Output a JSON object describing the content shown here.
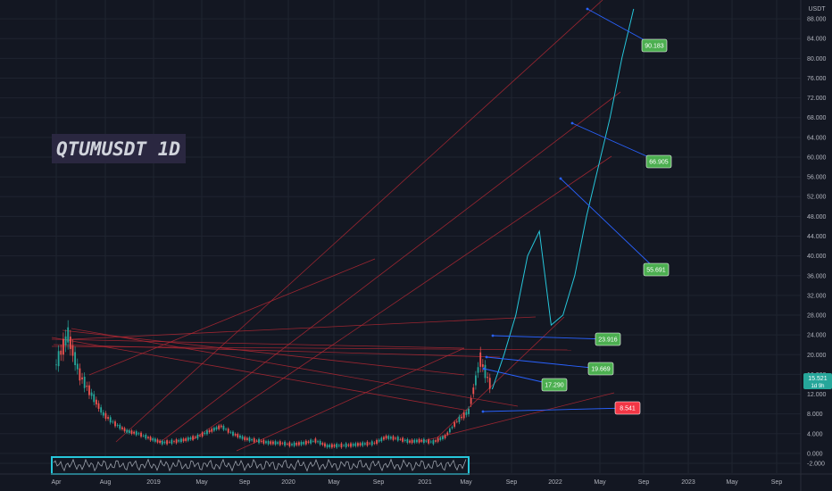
{
  "chart_data": {
    "type": "line",
    "title": "QTUMUSDT 1D",
    "currency": "USDT",
    "y_ticks": [
      "88.000",
      "84.000",
      "80.000",
      "76.000",
      "72.000",
      "68.000",
      "64.000",
      "60.000",
      "56.000",
      "52.000",
      "48.000",
      "44.000",
      "40.000",
      "36.000",
      "32.000",
      "28.000",
      "24.000",
      "20.000",
      "16.000",
      "12.000",
      "8.000",
      "4.000",
      "0.000",
      "-2.000"
    ],
    "x_ticks": [
      "Apr",
      "Aug",
      "2019",
      "May",
      "Sep",
      "2020",
      "May",
      "Sep",
      "2021",
      "May",
      "Sep",
      "2022",
      "May",
      "Sep",
      "2023",
      "May",
      "Sep"
    ],
    "ylim": [
      -2,
      90
    ],
    "grid": true,
    "current_price": {
      "label": "15.521",
      "sublabel": "1d 9h",
      "color": "#26a69a"
    },
    "price_series": {
      "name": "QTUMUSDT",
      "x": [
        "2018-04",
        "2018-05",
        "2018-06",
        "2018-07",
        "2018-08",
        "2018-09",
        "2018-10",
        "2018-11",
        "2018-12",
        "2019-01",
        "2019-02",
        "2019-03",
        "2019-04",
        "2019-05",
        "2019-06",
        "2019-07",
        "2019-08",
        "2019-09",
        "2019-10",
        "2019-11",
        "2019-12",
        "2020-01",
        "2020-02",
        "2020-03",
        "2020-04",
        "2020-05",
        "2020-06",
        "2020-07",
        "2020-08",
        "2020-09",
        "2020-10",
        "2020-11",
        "2020-12",
        "2021-01",
        "2021-02",
        "2021-03",
        "2021-04",
        "2021-05"
      ],
      "y": [
        18,
        24,
        16,
        12,
        8,
        6,
        4.5,
        4,
        3,
        2.2,
        2.4,
        2.8,
        3.4,
        4.5,
        5.5,
        4,
        3,
        2.6,
        2.2,
        2.1,
        1.8,
        2.1,
        2.6,
        1.5,
        1.6,
        1.7,
        1.9,
        2.1,
        3.3,
        3,
        2.4,
        2.6,
        2.3,
        3.4,
        6.5,
        8.5,
        19,
        13
      ]
    },
    "projection": {
      "x": [
        "2021-05",
        "2021-06",
        "2021-07",
        "2021-08",
        "2021-09",
        "2021-10",
        "2021-11",
        "2021-12",
        "2022-01",
        "2022-02",
        "2022-03",
        "2022-04",
        "2022-05"
      ],
      "y": [
        13,
        20,
        28,
        40,
        45,
        26,
        28,
        36,
        48,
        58,
        68,
        80,
        90
      ]
    },
    "annotations": [
      {
        "label": "90.183",
        "value": 90.183,
        "color": "#4caf50"
      },
      {
        "label": "66.905",
        "value": 66.905,
        "color": "#4caf50"
      },
      {
        "label": "55.691",
        "value": 55.691,
        "color": "#4caf50"
      },
      {
        "label": "23.916",
        "value": 23.916,
        "color": "#4caf50"
      },
      {
        "label": "19.669",
        "value": 19.669,
        "color": "#4caf50"
      },
      {
        "label": "17.290",
        "value": 17.29,
        "color": "#4caf50"
      },
      {
        "label": "8.541",
        "value": 8.541,
        "color": "#f23645"
      }
    ],
    "colors": {
      "background": "#131722",
      "grid": "#1f2430",
      "trendline": "#b22833",
      "projection": "#26c6da",
      "callout_line": "#2962ff",
      "up": "#26a69a",
      "down": "#ef5350",
      "indicator": "#26c6da"
    }
  }
}
